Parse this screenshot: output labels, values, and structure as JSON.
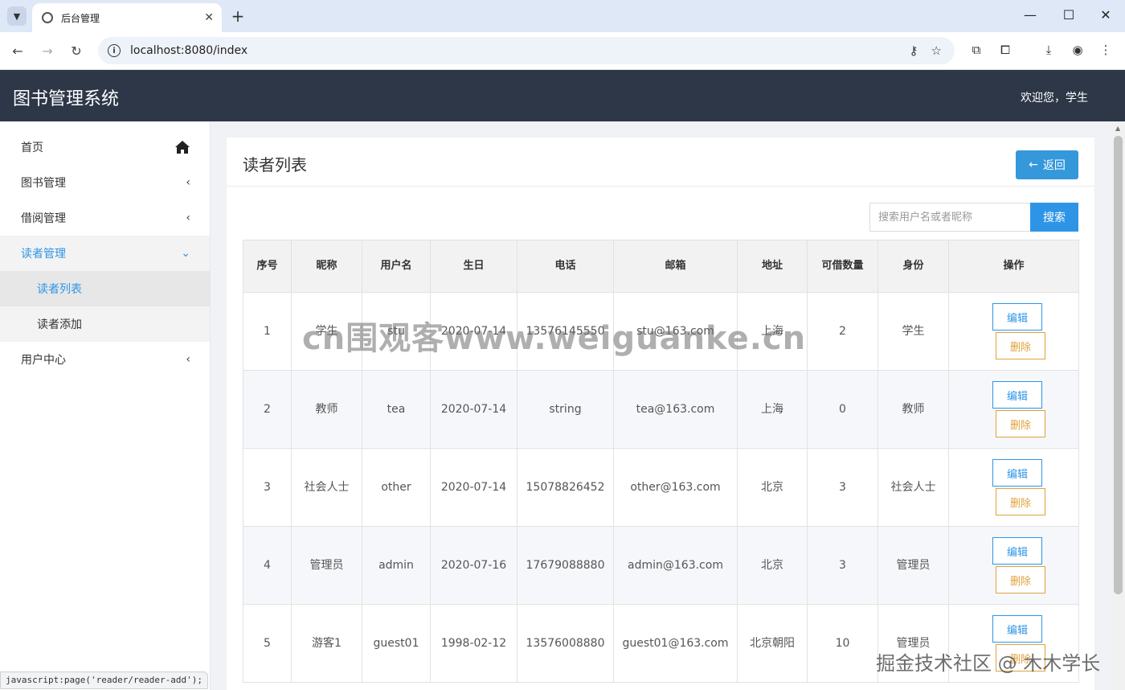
{
  "browser": {
    "tab_title": "后台管理",
    "url": "localhost:8080/index"
  },
  "header": {
    "app_title": "图书管理系统",
    "welcome": "欢迎您，学生"
  },
  "sidebar": {
    "items": [
      {
        "label": "首页"
      },
      {
        "label": "图书管理"
      },
      {
        "label": "借阅管理"
      },
      {
        "label": "读者管理"
      },
      {
        "label": "读者列表"
      },
      {
        "label": "读者添加"
      },
      {
        "label": "用户中心"
      }
    ]
  },
  "panel": {
    "title": "读者列表",
    "back_label": "返回"
  },
  "search": {
    "placeholder": "搜索用户名或者昵称",
    "button_label": "搜索"
  },
  "table": {
    "columns": [
      "序号",
      "昵称",
      "用户名",
      "生日",
      "电话",
      "邮箱",
      "地址",
      "可借数量",
      "身份",
      "操作"
    ],
    "rows": [
      {
        "no": "1",
        "nickname": "学生",
        "username": "stu",
        "birthday": "2020-07-14",
        "phone": "13576145550",
        "email": "stu@163.com",
        "address": "上海",
        "quota": "2",
        "role": "学生"
      },
      {
        "no": "2",
        "nickname": "教师",
        "username": "tea",
        "birthday": "2020-07-14",
        "phone": "string",
        "email": "tea@163.com",
        "address": "上海",
        "quota": "0",
        "role": "教师"
      },
      {
        "no": "3",
        "nickname": "社会人士",
        "username": "other",
        "birthday": "2020-07-14",
        "phone": "15078826452",
        "email": "other@163.com",
        "address": "北京",
        "quota": "3",
        "role": "社会人士"
      },
      {
        "no": "4",
        "nickname": "管理员",
        "username": "admin",
        "birthday": "2020-07-16",
        "phone": "17679088880",
        "email": "admin@163.com",
        "address": "北京",
        "quota": "3",
        "role": "管理员"
      },
      {
        "no": "5",
        "nickname": "游客1",
        "username": "guest01",
        "birthday": "1998-02-12",
        "phone": "13576008880",
        "email": "guest01@163.com",
        "address": "北京朝阳",
        "quota": "10",
        "role": "管理员"
      }
    ],
    "edit_label": "编辑",
    "delete_label": "删除"
  },
  "status_bar": "javascript:page('reader/reader-add');",
  "watermarks": {
    "center": "cn围观客www.weiguanke.cn",
    "corner": "掘金技术社区 @ 木木学长"
  },
  "colors": {
    "header_bg": "#2d3748",
    "accent": "#2e95e6",
    "danger": "#e0a23c"
  }
}
